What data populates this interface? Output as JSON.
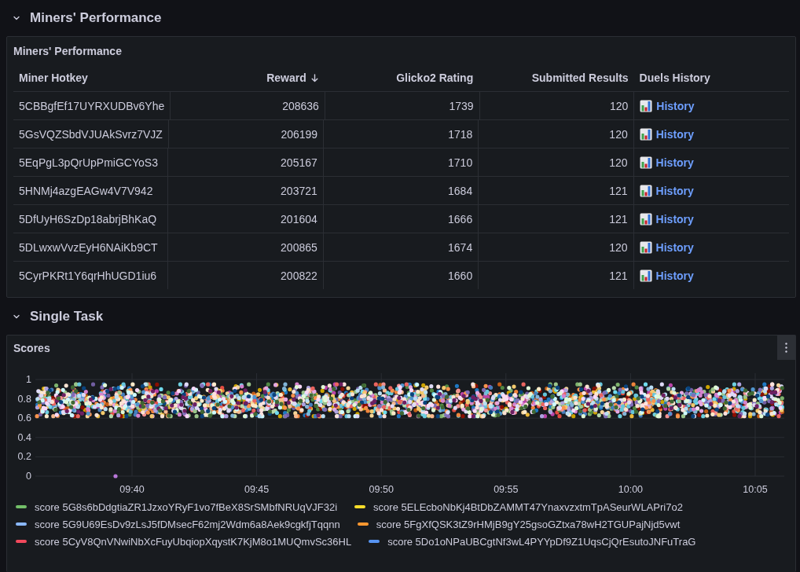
{
  "sections": [
    {
      "title": "Miners' Performance",
      "expanded": true,
      "panel": {
        "kind": "table",
        "title": "Miners' Performance",
        "columns": [
          {
            "label": "Miner Hotkey",
            "kind": "text",
            "sorted": false
          },
          {
            "label": "Reward",
            "kind": "number",
            "sorted": true
          },
          {
            "label": "Glicko2 Rating",
            "kind": "number",
            "sorted": false
          },
          {
            "label": "Submitted Results",
            "kind": "number",
            "sorted": false
          },
          {
            "label": "Duels History",
            "kind": "link",
            "sorted": false
          }
        ],
        "rows": [
          [
            "5CBBgfEf17UYRXUDBv6Yhe",
            "208636",
            "1739",
            "120",
            "History"
          ],
          [
            "5GsVQZSbdVJUAkSvrz7VJZ",
            "206199",
            "1718",
            "120",
            "History"
          ],
          [
            "5EqPgL3pQrUpPmiGCYoS3",
            "205167",
            "1710",
            "120",
            "History"
          ],
          [
            "5HNMj4azgEAGw4V7V942",
            "203721",
            "1684",
            "121",
            "History"
          ],
          [
            "5DfUyH6SzDp18abrjBhKaQ",
            "201604",
            "1666",
            "121",
            "History"
          ],
          [
            "5DLwxwVvzEyH6NAiKb9CT",
            "200865",
            "1674",
            "120",
            "History"
          ],
          [
            "5CyrPKRt1Y6qrHhUGD1iu6",
            "200822",
            "1660",
            "121",
            "History"
          ]
        ]
      }
    },
    {
      "title": "Single Task",
      "expanded": true,
      "panel": {
        "kind": "chart",
        "title": "Scores",
        "chart_data": {
          "type": "scatter",
          "categories": [
            "09:40",
            "09:45",
            "09:50",
            "09:55",
            "10:00",
            "10:05"
          ],
          "ylim": [
            0,
            1
          ],
          "yticks": [
            0,
            0.2,
            0.4,
            0.6,
            0.8,
            1
          ],
          "grid": true
        },
        "legend": [
          {
            "name": "score 5G8s6bDdgtiaZR1JzxoYRyF1vo7fBeX8SrSMbfNRUqVJF32i",
            "color": "#73bf69"
          },
          {
            "name": "score 5ELEcboNbKj4BtDbZAMMT47YnaxvzxtmTpASeurWLAPri7o2",
            "color": "#fade2a"
          },
          {
            "name": "score 5G9U69EsDv9zLsJ5fDMsecF62mj2Wdm6a8Aek9cgkfjTqqnn",
            "color": "#8ab8ff"
          },
          {
            "name": "score 5FgXfQSK3tZ9rHMjB9gY25gsoGZtxa78wH2TGUPajNjd5vwt",
            "color": "#ff9830"
          },
          {
            "name": "score 5CyV8QnVNwiNbXcFuyUbqiopXqystK7KjM8o1MUQmvSc36HL",
            "color": "#f2495c"
          },
          {
            "name": "score 5Do1oNPaUBCgtNf3wL4PYYpDf9Z1UqsCjQrEsutoJNFuTraG",
            "color": "#5794f2"
          }
        ]
      }
    }
  ]
}
